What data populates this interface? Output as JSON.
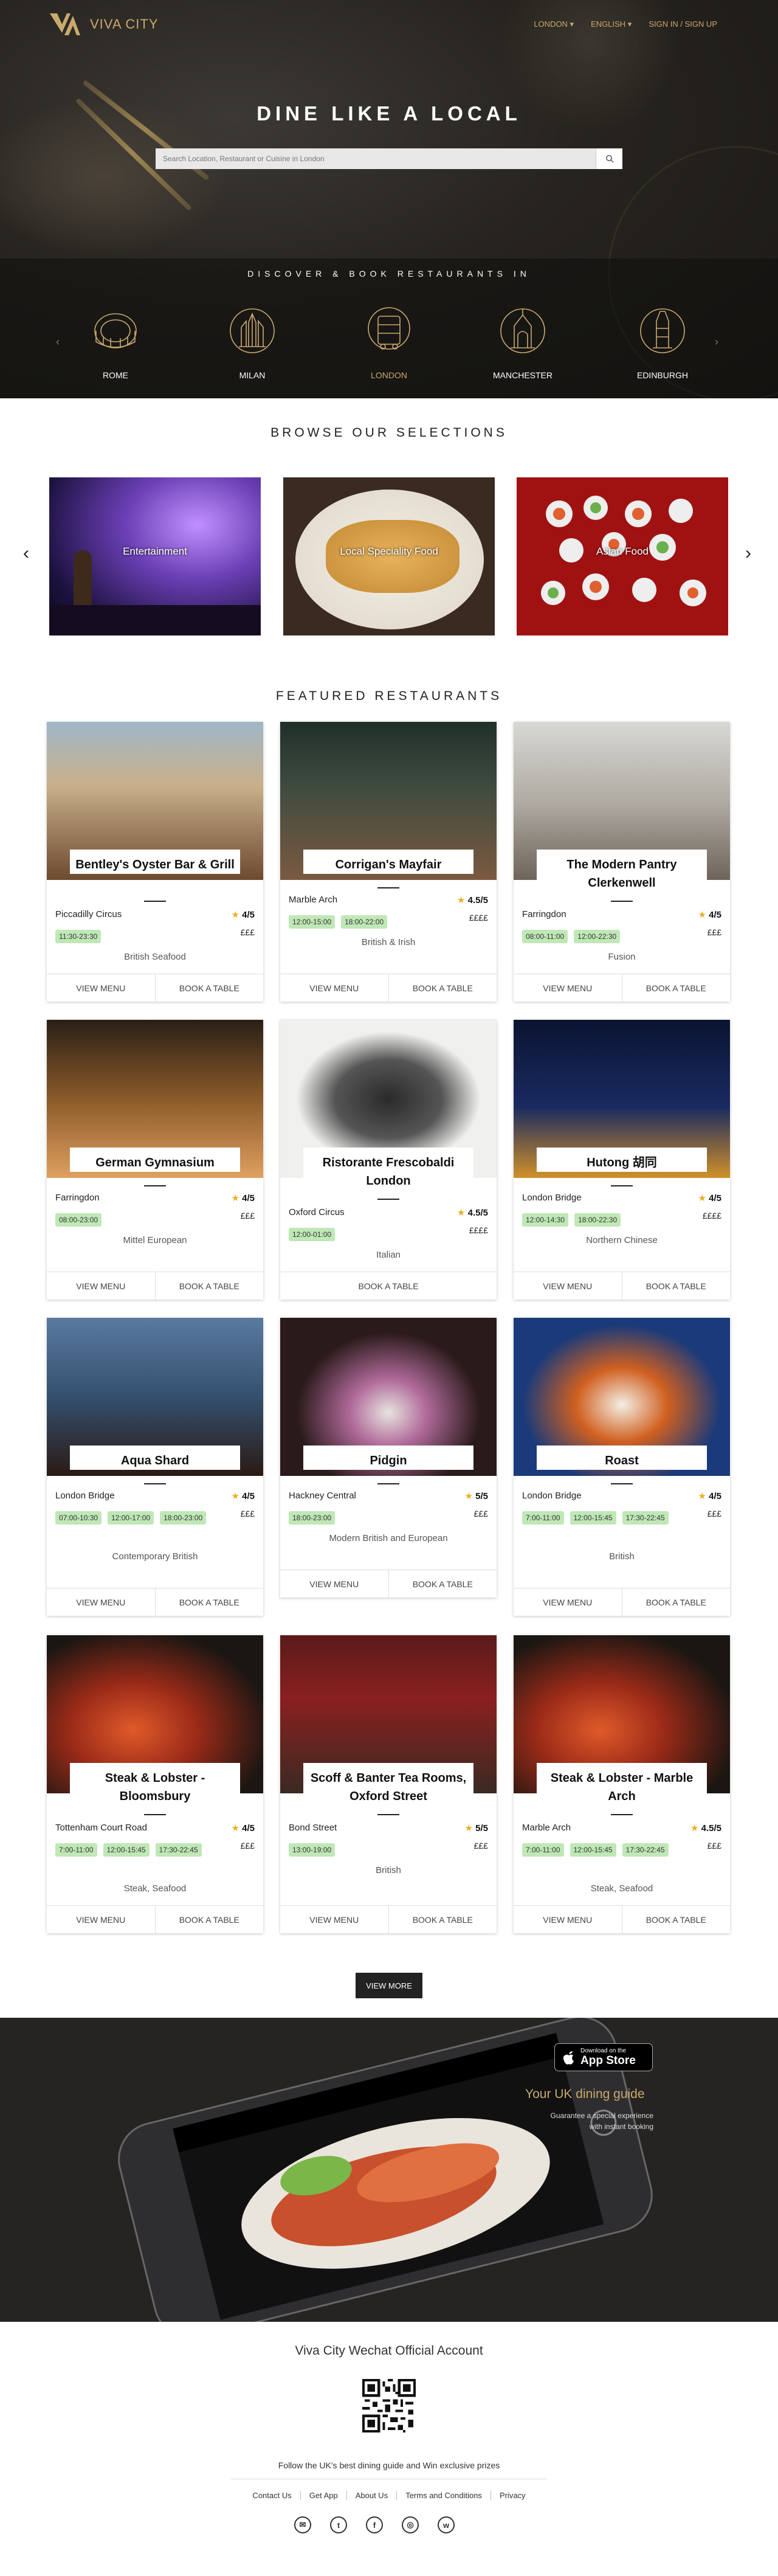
{
  "header": {
    "brand": "VIVA CITY",
    "nav": [
      {
        "label": "LONDON ▾"
      },
      {
        "label": "ENGLISH ▾"
      },
      {
        "label": "SIGN IN / SIGN UP"
      }
    ]
  },
  "hero": {
    "title": "DINE LIKE A LOCAL",
    "search_placeholder": "Search Location, Restaurant or Cuisine in London",
    "discover": "DISCOVER & BOOK RESTAURANTS IN",
    "cities": [
      {
        "name": "ROME"
      },
      {
        "name": "MILAN"
      },
      {
        "name": "LONDON"
      },
      {
        "name": "MANCHESTER"
      },
      {
        "name": "EDINBURGH"
      }
    ],
    "active_city": "LONDON"
  },
  "browse": {
    "title": "BROWSE OUR SELECTIONS",
    "items": [
      {
        "label": "Entertainment"
      },
      {
        "label": "Local Speciality Food"
      },
      {
        "label": "Asian Food"
      }
    ]
  },
  "featured": {
    "title": "FEATURED RESTAURANTS",
    "restaurants": [
      {
        "name": "Bentley's Oyster Bar & Grill",
        "location": "Piccadilly Circus",
        "rating": "4/5",
        "price": "£££",
        "times": [
          "11:30-23:30"
        ],
        "cuisine": "British Seafood",
        "view": "VIEW MENU",
        "book": "BOOK A TABLE"
      },
      {
        "name": "Corrigan's Mayfair",
        "location": "Marble Arch",
        "rating": "4.5/5",
        "price": "££££",
        "times": [
          "12:00-15:00",
          "18:00-22:00"
        ],
        "cuisine": "British & Irish",
        "view": "VIEW MENU",
        "book": "BOOK A TABLE"
      },
      {
        "name": "The Modern Pantry Clerkenwell",
        "location": "Farringdon",
        "rating": "4/5",
        "price": "£££",
        "times": [
          "08:00-11:00",
          "12:00-22:30"
        ],
        "cuisine": "Fusion",
        "view": "VIEW MENU",
        "book": "BOOK A TABLE"
      },
      {
        "name": "German Gymnasium",
        "location": "Farringdon",
        "rating": "4/5",
        "price": "£££",
        "times": [
          "08:00-23:00"
        ],
        "cuisine": "Mittel European",
        "view": "VIEW MENU",
        "book": "BOOK A TABLE"
      },
      {
        "name": "Ristorante Frescobaldi London",
        "location": "Oxford Circus",
        "rating": "4.5/5",
        "price": "££££",
        "times": [
          "12:00-01:00"
        ],
        "cuisine": "Italian",
        "view": "",
        "book": "BOOK A TABLE"
      },
      {
        "name": "Hutong 胡同",
        "location": "London Bridge",
        "rating": "4/5",
        "price": "££££",
        "times": [
          "12:00-14:30",
          "18:00-22:30"
        ],
        "cuisine": "Northern Chinese",
        "view": "VIEW MENU",
        "book": "BOOK A TABLE"
      },
      {
        "name": "Aqua Shard",
        "location": "London Bridge",
        "rating": "4/5",
        "price": "£££",
        "times": [
          "07:00-10:30",
          "12:00-17:00",
          "18:00-23:00"
        ],
        "cuisine": "Contemporary British",
        "view": "VIEW MENU",
        "book": "BOOK A TABLE"
      },
      {
        "name": "Pidgin",
        "location": "Hackney Central",
        "rating": "5/5",
        "price": "£££",
        "times": [
          "18:00-23:00"
        ],
        "cuisine": "Modern British and European",
        "view": "VIEW MENU",
        "book": "BOOK A TABLE"
      },
      {
        "name": "Roast",
        "location": "London Bridge",
        "rating": "4/5",
        "price": "£££",
        "times": [
          "7:00-11:00",
          "12:00-15:45",
          "17:30-22:45"
        ],
        "cuisine": "British",
        "view": "VIEW MENU",
        "book": "BOOK A TABLE"
      },
      {
        "name": "Steak & Lobster - Bloomsbury",
        "location": "Tottenham Court Road",
        "rating": "4/5",
        "price": "£££",
        "times": [
          "7:00-11:00",
          "12:00-15:45",
          "17:30-22:45"
        ],
        "cuisine": "Steak, Seafood",
        "view": "VIEW MENU",
        "book": "BOOK A TABLE"
      },
      {
        "name": "Scoff & Banter Tea Rooms, Oxford Street",
        "location": "Bond Street",
        "rating": "5/5",
        "price": "£££",
        "times": [
          "13:00-19:00"
        ],
        "cuisine": "British",
        "view": "VIEW MENU",
        "book": "BOOK A TABLE"
      },
      {
        "name": "Steak & Lobster - Marble Arch",
        "location": "Marble Arch",
        "rating": "4.5/5",
        "price": "£££",
        "times": [
          "7:00-11:00",
          "12:00-15:45",
          "17:30-22:45"
        ],
        "cuisine": "Steak, Seafood",
        "view": "VIEW MENU",
        "book": "BOOK A TABLE"
      }
    ],
    "view_more": "VIEW MORE"
  },
  "app": {
    "store_small": "Download on the",
    "store_big": "App Store",
    "title": "Your UK dining guide",
    "subtitle": "Guarantee a special experience with instant booking"
  },
  "footer": {
    "wechat": "Viva City Wechat Official Account",
    "follow": "Follow the UK's best dining guide and Win exclusive prizes",
    "links": [
      {
        "label": "Contact Us"
      },
      {
        "label": "Get App"
      },
      {
        "label": "About Us"
      },
      {
        "label": "Terms and Conditions"
      },
      {
        "label": "Privacy"
      }
    ],
    "socials": [
      {
        "icon": "email-icon",
        "glyph": "✉"
      },
      {
        "icon": "twitter-icon",
        "glyph": "t"
      },
      {
        "icon": "facebook-icon",
        "glyph": "f"
      },
      {
        "icon": "instagram-icon",
        "glyph": "◎"
      },
      {
        "icon": "weibo-icon",
        "glyph": "w"
      }
    ]
  }
}
